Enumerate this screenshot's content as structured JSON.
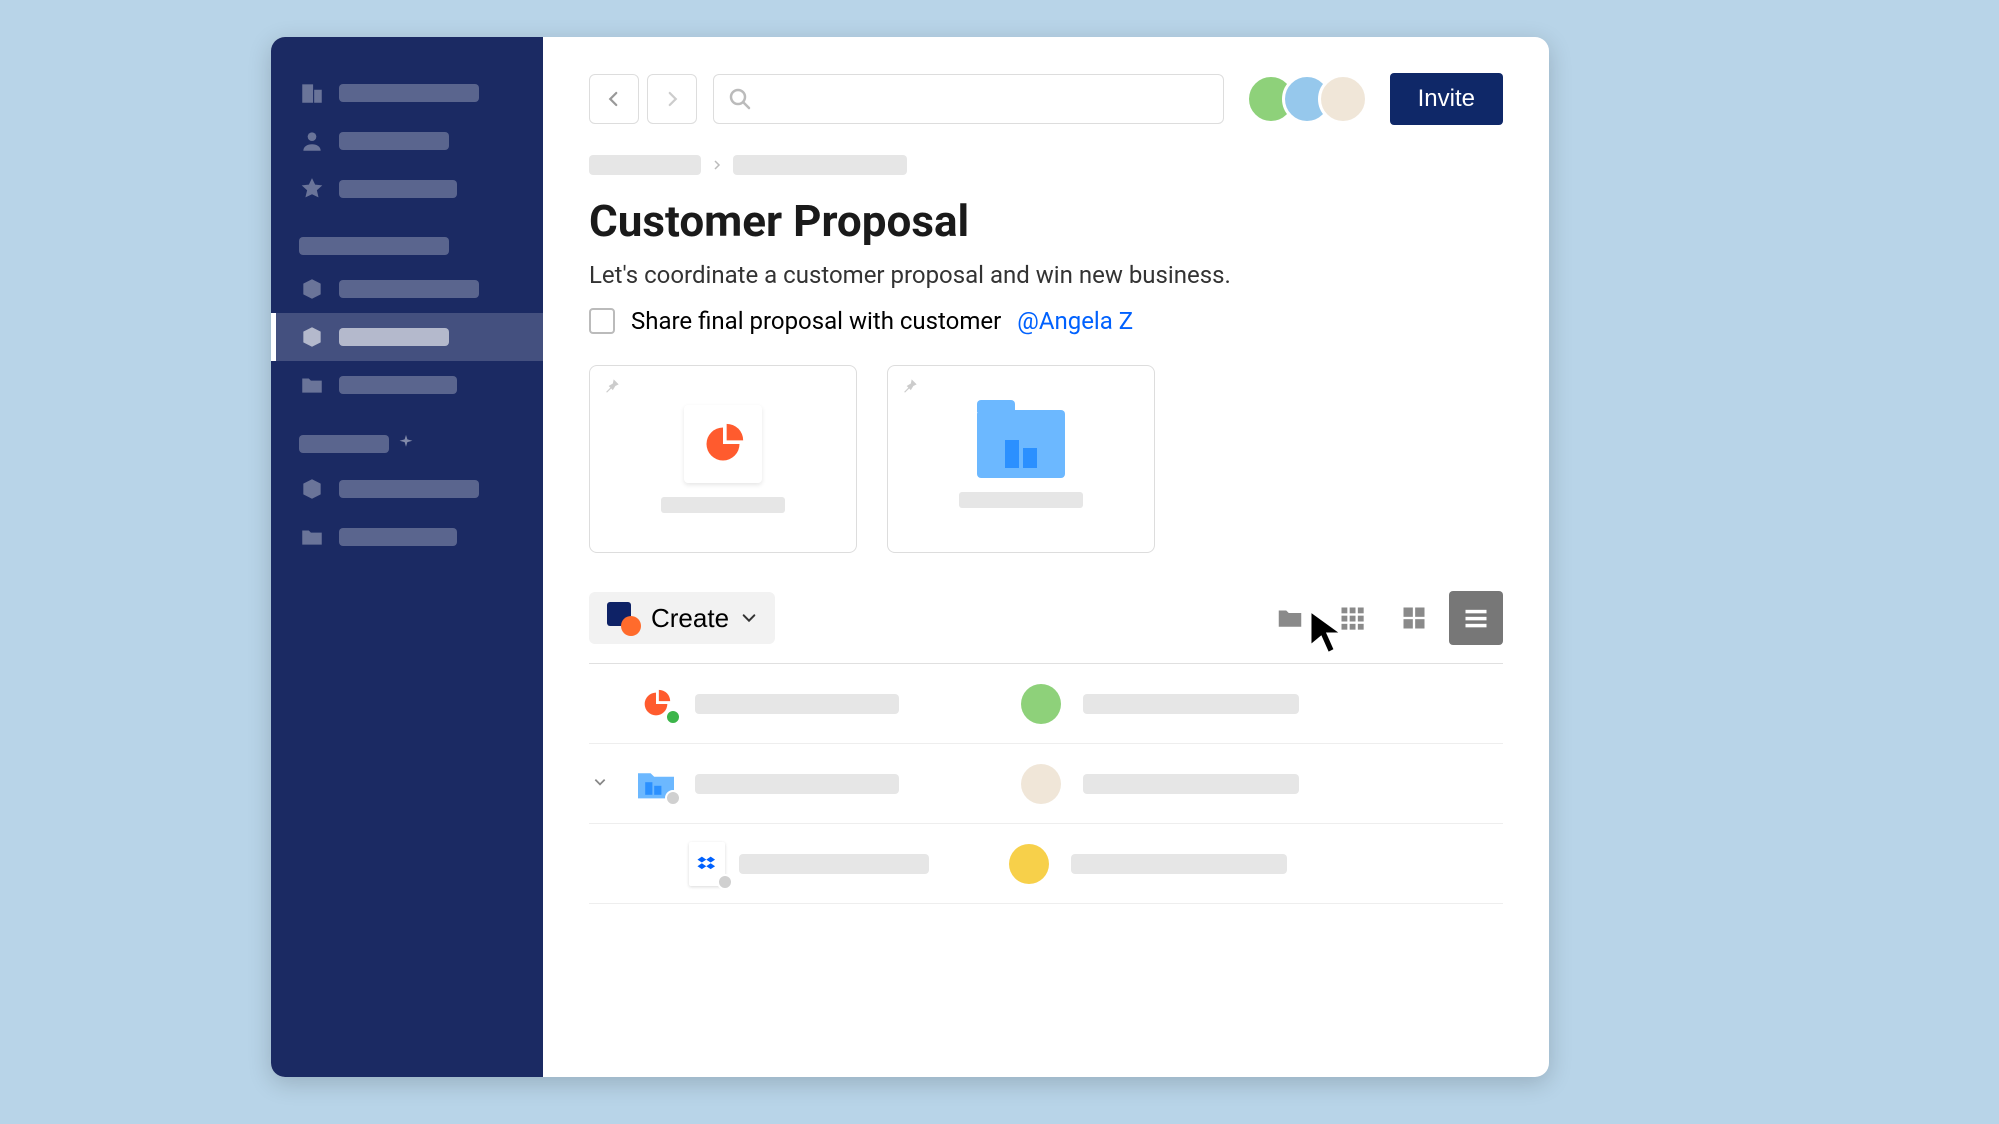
{
  "header": {
    "search_placeholder": "",
    "invite_label": "Invite",
    "avatars": [
      {
        "bg": "#8ed17a"
      },
      {
        "bg": "#96c8ec"
      },
      {
        "bg": "#f0e6d8"
      }
    ]
  },
  "page": {
    "title": "Customer Proposal",
    "subtitle": "Let's coordinate a customer proposal and win new business."
  },
  "task": {
    "label": "Share final proposal with customer",
    "mention": "@Angela Z",
    "checked": false
  },
  "pinned": [
    {
      "type": "presentation"
    },
    {
      "type": "folder"
    }
  ],
  "toolbar": {
    "create_label": "Create",
    "view": "list"
  },
  "file_rows": [
    {
      "icon": "presentation",
      "badge": "#3cb54a",
      "avatar_bg": "#8ed17a"
    },
    {
      "icon": "folder",
      "badge": "#c8c8c8",
      "caret": true,
      "avatar_bg": "#f0e6d8"
    },
    {
      "icon": "dropbox",
      "badge": "#c8c8c8",
      "indent": true,
      "avatar_bg": "#f7d04a"
    }
  ]
}
